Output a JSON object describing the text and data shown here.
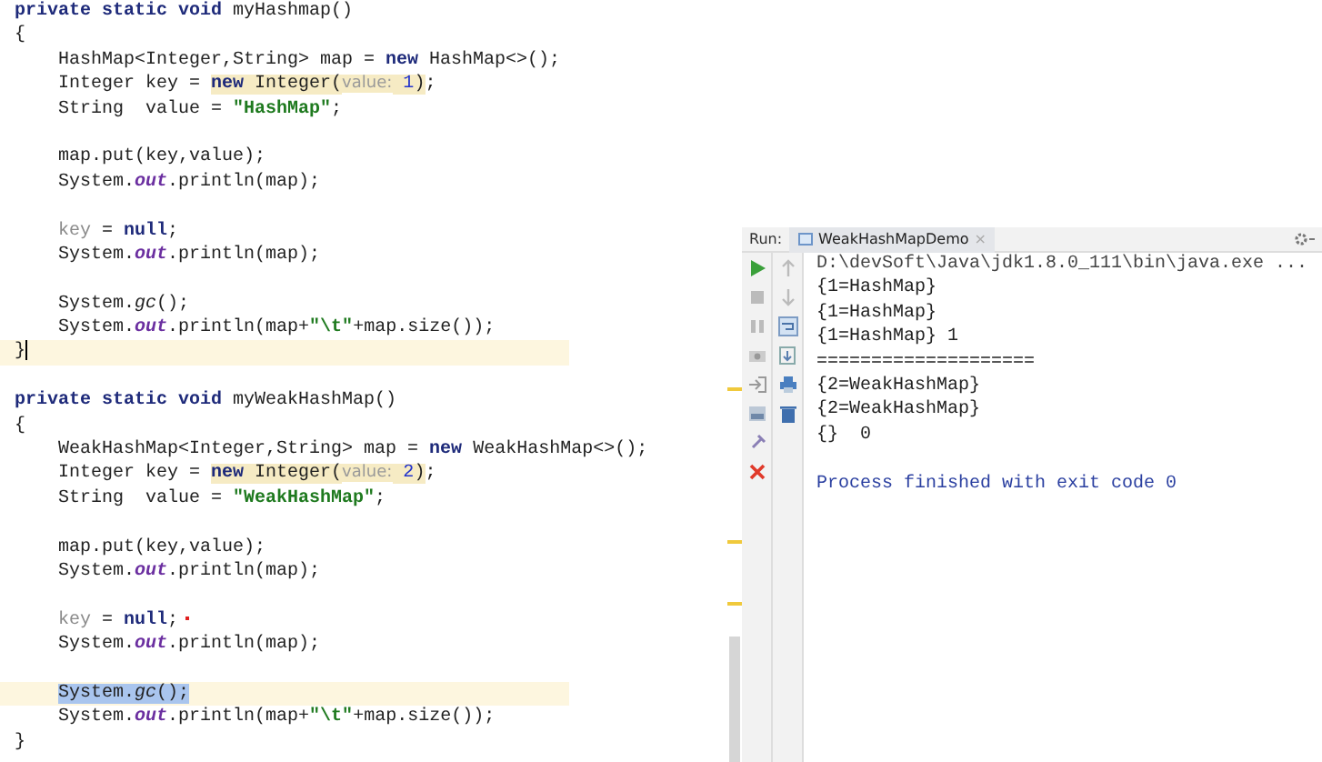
{
  "editor": {
    "lines": [
      {
        "kind": "code",
        "highlighted": false,
        "caret": false,
        "marker": false,
        "tokens": [
          {
            "t": "private static void ",
            "kind": "kw"
          },
          {
            "t": "myHashmap()",
            "kind": "plain"
          }
        ]
      },
      {
        "kind": "code",
        "highlighted": false,
        "caret": false,
        "marker": false,
        "tokens": [
          {
            "t": "{",
            "kind": "plain"
          }
        ]
      },
      {
        "kind": "indented",
        "highlighted": false,
        "caret": false,
        "marker": false,
        "tokens": [
          {
            "t": "HashMap<Integer,String> map = ",
            "kind": "plain"
          },
          {
            "t": "new",
            "kind": "kw"
          },
          {
            "t": " HashMap<>();",
            "kind": "plain"
          }
        ]
      },
      {
        "kind": "indented",
        "highlighted": false,
        "caret": false,
        "marker": false,
        "tokens": [
          {
            "t": "Integer key = ",
            "kind": "plain"
          },
          {
            "t": "new",
            "kind": "warn-kw"
          },
          {
            "t": " Integer(",
            "kind": "warn-plain"
          },
          {
            "t": "value:",
            "kind": "warn-hint"
          },
          {
            "t": " 1",
            "kind": "warn-num"
          },
          {
            "t": ")",
            "kind": "warn-plain"
          },
          {
            "t": ";",
            "kind": "plain"
          }
        ]
      },
      {
        "kind": "indented",
        "highlighted": false,
        "caret": false,
        "marker": false,
        "tokens": [
          {
            "t": "String  value = ",
            "kind": "plain"
          },
          {
            "t": "\"HashMap\"",
            "kind": "str"
          },
          {
            "t": ";",
            "kind": "plain"
          }
        ]
      },
      {
        "kind": "blank"
      },
      {
        "kind": "indented",
        "highlighted": false,
        "caret": false,
        "marker": false,
        "tokens": [
          {
            "t": "map.put(key,value);",
            "kind": "plain"
          }
        ]
      },
      {
        "kind": "indented",
        "highlighted": false,
        "caret": false,
        "marker": false,
        "tokens": [
          {
            "t": "System.",
            "kind": "plain"
          },
          {
            "t": "out",
            "kind": "field"
          },
          {
            "t": ".println(map);",
            "kind": "plain"
          }
        ]
      },
      {
        "kind": "blank"
      },
      {
        "kind": "indented",
        "highlighted": false,
        "caret": false,
        "marker": false,
        "tokens": [
          {
            "t": "key",
            "kind": "dim"
          },
          {
            "t": " = ",
            "kind": "plain"
          },
          {
            "t": "null",
            "kind": "kw"
          },
          {
            "t": ";",
            "kind": "plain"
          }
        ]
      },
      {
        "kind": "indented",
        "highlighted": false,
        "caret": false,
        "marker": false,
        "tokens": [
          {
            "t": "System.",
            "kind": "plain"
          },
          {
            "t": "out",
            "kind": "field"
          },
          {
            "t": ".println(map);",
            "kind": "plain"
          }
        ]
      },
      {
        "kind": "blank"
      },
      {
        "kind": "indented",
        "highlighted": false,
        "caret": false,
        "marker": false,
        "tokens": [
          {
            "t": "System.",
            "kind": "plain"
          },
          {
            "t": "gc",
            "kind": "call"
          },
          {
            "t": "();",
            "kind": "plain"
          }
        ]
      },
      {
        "kind": "indented",
        "highlighted": false,
        "caret": false,
        "marker": false,
        "tokens": [
          {
            "t": "System.",
            "kind": "plain"
          },
          {
            "t": "out",
            "kind": "field"
          },
          {
            "t": ".println(map+",
            "kind": "plain"
          },
          {
            "t": "\"\\t\"",
            "kind": "str"
          },
          {
            "t": "+map.size());",
            "kind": "plain"
          }
        ]
      },
      {
        "kind": "code",
        "highlighted": true,
        "caret": true,
        "marker": false,
        "tokens": [
          {
            "t": "}",
            "kind": "plain"
          }
        ]
      },
      {
        "kind": "blank"
      },
      {
        "kind": "code",
        "highlighted": false,
        "caret": false,
        "marker": false,
        "tokens": [
          {
            "t": "private static void ",
            "kind": "kw"
          },
          {
            "t": "myWeakHashMap()",
            "kind": "plain"
          }
        ]
      },
      {
        "kind": "code",
        "highlighted": false,
        "caret": false,
        "marker": false,
        "tokens": [
          {
            "t": "{",
            "kind": "plain"
          }
        ]
      },
      {
        "kind": "indented",
        "highlighted": false,
        "caret": false,
        "marker": false,
        "tokens": [
          {
            "t": "WeakHashMap<Integer,String> map = ",
            "kind": "plain"
          },
          {
            "t": "new",
            "kind": "kw"
          },
          {
            "t": " WeakHashMap<>();",
            "kind": "plain"
          }
        ]
      },
      {
        "kind": "indented",
        "highlighted": false,
        "caret": false,
        "marker": false,
        "tokens": [
          {
            "t": "Integer key = ",
            "kind": "plain"
          },
          {
            "t": "new",
            "kind": "warn-kw"
          },
          {
            "t": " Integer(",
            "kind": "warn-plain"
          },
          {
            "t": "value:",
            "kind": "warn-hint"
          },
          {
            "t": " 2",
            "kind": "warn-num"
          },
          {
            "t": ")",
            "kind": "warn-plain"
          },
          {
            "t": ";",
            "kind": "plain"
          }
        ]
      },
      {
        "kind": "indented",
        "highlighted": false,
        "caret": false,
        "marker": false,
        "tokens": [
          {
            "t": "String  value = ",
            "kind": "plain"
          },
          {
            "t": "\"WeakHashMap\"",
            "kind": "str"
          },
          {
            "t": ";",
            "kind": "plain"
          }
        ]
      },
      {
        "kind": "blank"
      },
      {
        "kind": "indented",
        "highlighted": false,
        "caret": false,
        "marker": false,
        "tokens": [
          {
            "t": "map.put(key,value);",
            "kind": "plain"
          }
        ]
      },
      {
        "kind": "indented",
        "highlighted": false,
        "caret": false,
        "marker": false,
        "tokens": [
          {
            "t": "System.",
            "kind": "plain"
          },
          {
            "t": "out",
            "kind": "field"
          },
          {
            "t": ".println(map);",
            "kind": "plain"
          }
        ]
      },
      {
        "kind": "blank"
      },
      {
        "kind": "indented",
        "highlighted": false,
        "caret": false,
        "marker": true,
        "tokens": [
          {
            "t": "key",
            "kind": "dim"
          },
          {
            "t": " = ",
            "kind": "plain"
          },
          {
            "t": "null",
            "kind": "kw"
          },
          {
            "t": ";",
            "kind": "plain"
          }
        ]
      },
      {
        "kind": "indented",
        "highlighted": false,
        "caret": false,
        "marker": false,
        "tokens": [
          {
            "t": "System.",
            "kind": "plain"
          },
          {
            "t": "out",
            "kind": "field"
          },
          {
            "t": ".println(map);",
            "kind": "plain"
          }
        ]
      },
      {
        "kind": "blank"
      },
      {
        "kind": "indented",
        "highlighted": true,
        "caret": false,
        "marker": false,
        "tokens": [
          {
            "t": "System.",
            "kind": "sel-plain"
          },
          {
            "t": "gc",
            "kind": "sel-call"
          },
          {
            "t": "();",
            "kind": "sel-plain"
          }
        ]
      },
      {
        "kind": "indented",
        "highlighted": false,
        "caret": false,
        "marker": false,
        "tokens": [
          {
            "t": "System.",
            "kind": "plain"
          },
          {
            "t": "out",
            "kind": "field"
          },
          {
            "t": ".println(map+",
            "kind": "plain"
          },
          {
            "t": "\"\\t\"",
            "kind": "str"
          },
          {
            "t": "+map.size());",
            "kind": "plain"
          }
        ]
      },
      {
        "kind": "code",
        "highlighted": false,
        "caret": false,
        "marker": false,
        "tokens": [
          {
            "t": "}",
            "kind": "plain"
          }
        ]
      }
    ]
  },
  "run_panel": {
    "label": "Run:",
    "tab": {
      "title": "WeakHashMapDemo",
      "close": "×"
    },
    "console": [
      {
        "kind": "command",
        "text": "D:\\devSoft\\Java\\jdk1.8.0_111\\bin\\java.exe ..."
      },
      {
        "kind": "output",
        "text": "{1=HashMap}"
      },
      {
        "kind": "output",
        "text": "{1=HashMap}"
      },
      {
        "kind": "output",
        "text": "{1=HashMap} 1"
      },
      {
        "kind": "output",
        "text": "===================="
      },
      {
        "kind": "output",
        "text": "{2=WeakHashMap}"
      },
      {
        "kind": "output",
        "text": "{2=WeakHashMap}"
      },
      {
        "kind": "output",
        "text": "{}  0"
      },
      {
        "kind": "blank"
      },
      {
        "kind": "system",
        "text": "Process finished with exit code 0"
      }
    ]
  }
}
